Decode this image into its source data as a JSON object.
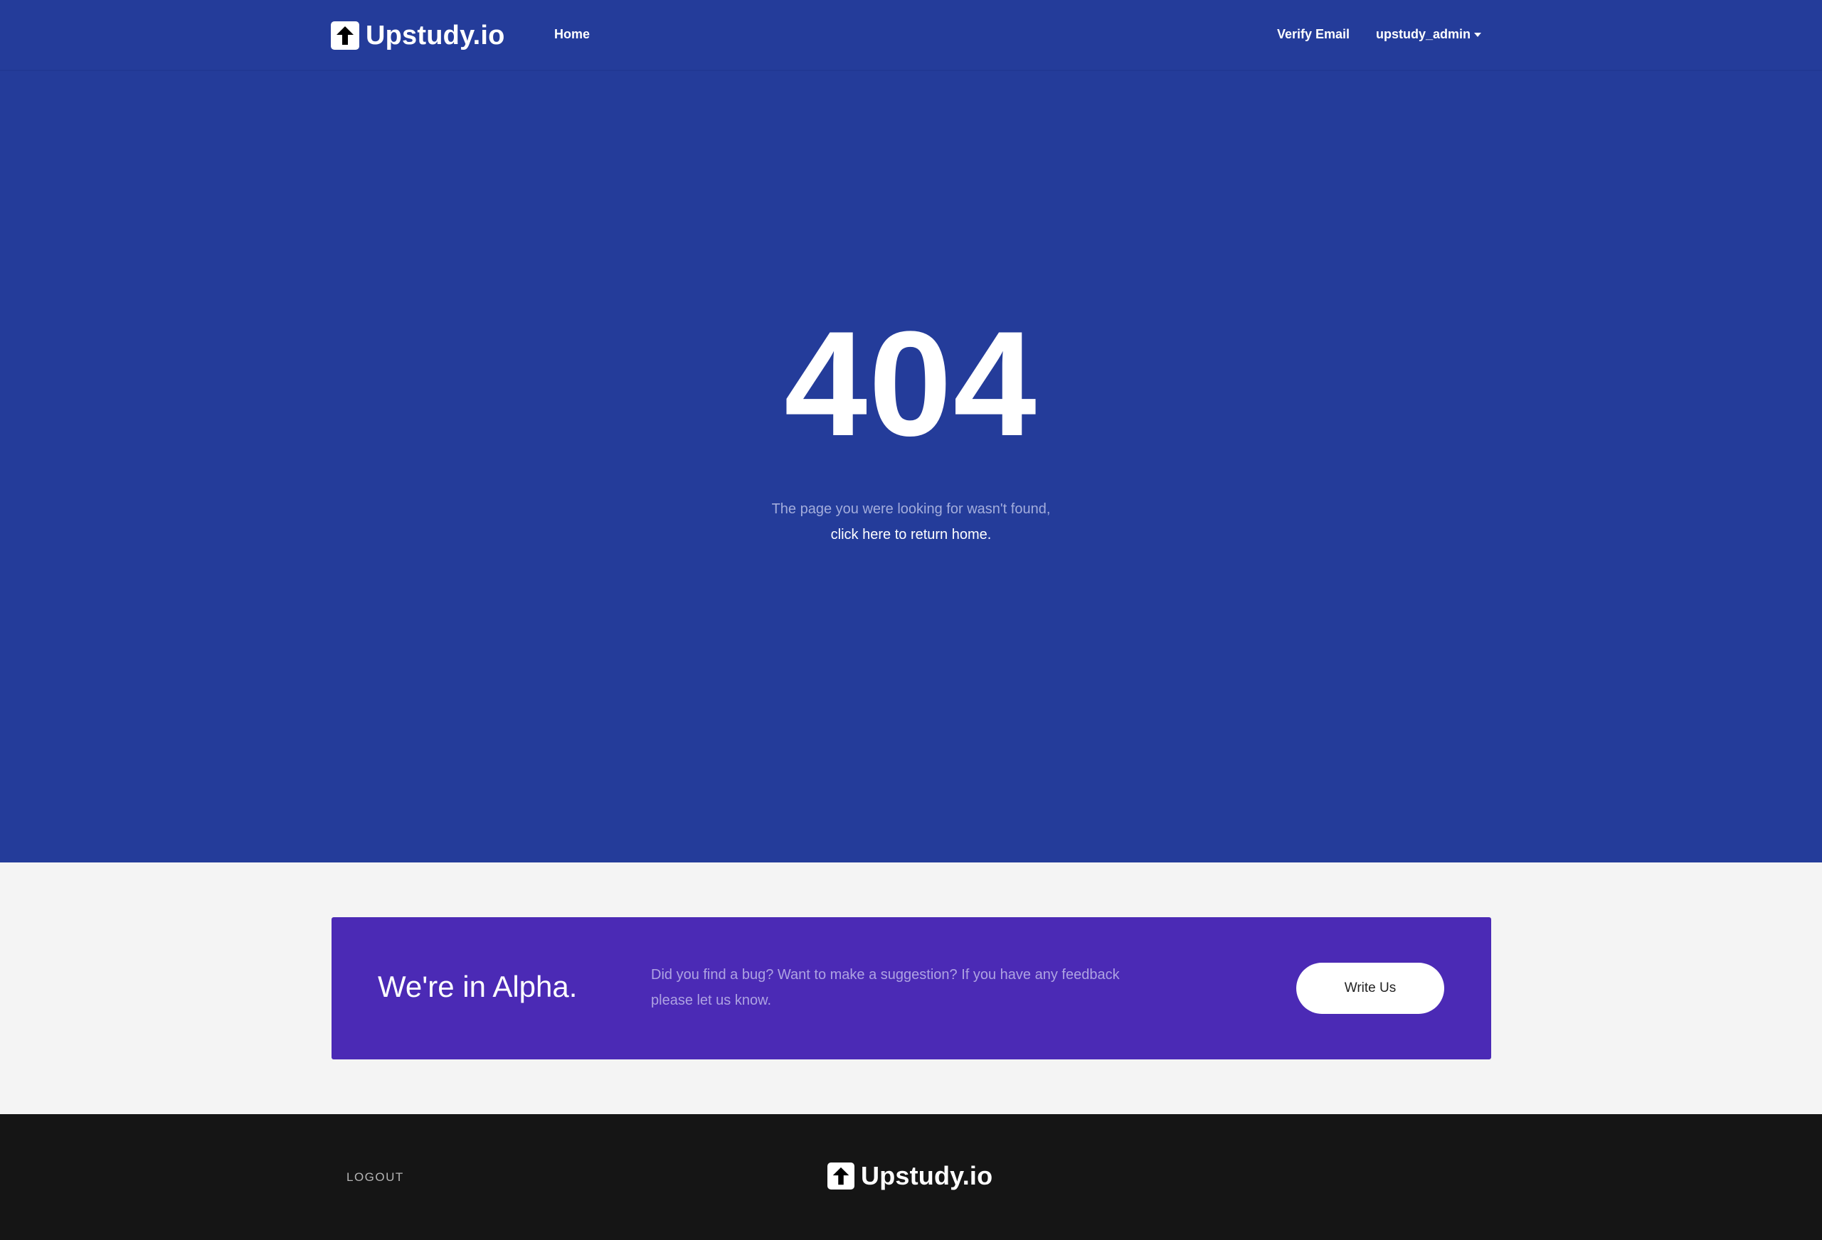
{
  "nav": {
    "brand": "Upstudy.io",
    "home": "Home",
    "verify_email": "Verify Email",
    "user": "upstudy_admin"
  },
  "error": {
    "code": "404",
    "message": "The page you were looking for wasn't found,",
    "link": "click here to return home."
  },
  "alpha": {
    "title": "We're in Alpha.",
    "text": "Did you find a bug? Want to make a suggestion? If you have any feedback please let us know.",
    "button": "Write Us"
  },
  "footer": {
    "logout": "LOGOUT",
    "brand": "Upstudy.io"
  },
  "colors": {
    "hero_bg": "#243c9a",
    "alpha_bg": "#4b2ab5",
    "footer_bg": "#151515",
    "page_bg": "#f4f4f4"
  }
}
